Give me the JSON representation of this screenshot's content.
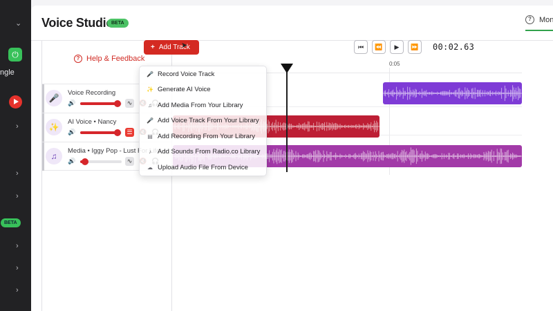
{
  "app": {
    "title": "Voice Studio",
    "beta_badge": "BETA",
    "right_tab_label": "Mon"
  },
  "sidebar": {
    "items": [
      {
        "icon": "power-icon"
      },
      {
        "label": "ngle"
      },
      {
        "icon": "youtube-icon"
      }
    ],
    "beta_badge": "BETA"
  },
  "tracks_panel": {
    "help_label": "Help & Feedback",
    "tracks": [
      {
        "name": "Voice Recording",
        "icon": "microphone-icon",
        "volume_fraction": 0.9,
        "accent": "#c9c9ce"
      },
      {
        "name": "AI Voice • Nancy",
        "icon": "magic-wand-icon",
        "volume_fraction": 0.9,
        "accent": "#c9c9ce"
      },
      {
        "name": "Media • Iggy Pop - Lust For Life",
        "icon": "music-note-icon",
        "volume_fraction": 0.12,
        "accent": "#c9c9ce"
      }
    ]
  },
  "toolbar": {
    "add_track_label": "Add Track",
    "time": "00:02.63"
  },
  "timeline": {
    "ruler_label": "0:05"
  },
  "add_track_menu": {
    "items": [
      {
        "label": "Record Voice Track",
        "icon": "microphone-icon"
      },
      {
        "label": "Generate AI Voice",
        "icon": "magic-wand-icon"
      },
      {
        "label": "Add Media From Your Library",
        "icon": "music-note-icon"
      },
      {
        "label": "Add Voice Track From Your Library",
        "icon": "microphone-icon"
      },
      {
        "label": "Add Recording From Your Library",
        "icon": "recording-icon"
      },
      {
        "label": "Add Sounds From Radio.co Library",
        "icon": "sound-icon"
      },
      {
        "label": "Upload Audio File From Device",
        "icon": "upload-icon"
      }
    ]
  },
  "colors": {
    "accent_red": "#d42a22",
    "brand_green": "#38c15a",
    "voice_clip": "#7e3bd6",
    "ai_clip": "#bd1f35",
    "media_clip": "#a23aa8"
  }
}
